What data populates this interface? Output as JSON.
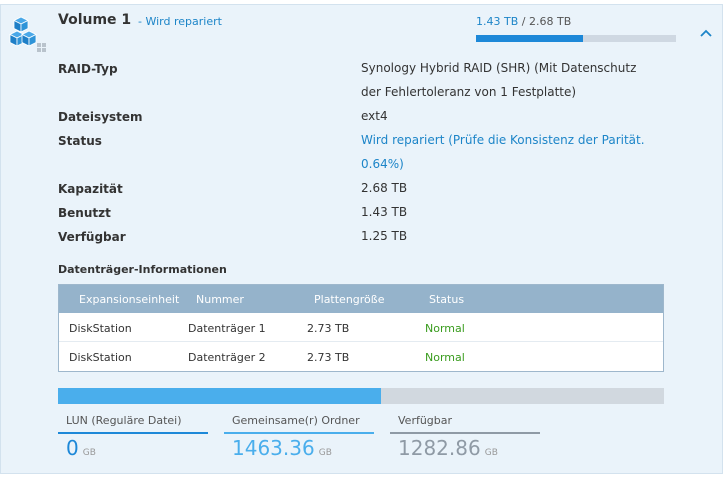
{
  "volume": {
    "title": "Volume 1",
    "status_separator": "-",
    "status": "Wird repariert",
    "usage_used": "1.43 TB",
    "usage_sep": "/",
    "usage_total": "2.68 TB",
    "usage_fraction": 0.533
  },
  "info": {
    "raid_label": "RAID-Typ",
    "raid_value_line1": "Synology Hybrid RAID (SHR) (Mit Datenschutz",
    "raid_value_line2": "der Fehlertoleranz von 1 Festplatte)",
    "fs_label": "Dateisystem",
    "fs_value": "ext4",
    "status_label": "Status",
    "status_value_line1": "Wird repariert (Prüfe die Konsistenz der Parität.",
    "status_value_line2": "0.64%)",
    "capacity_label": "Kapazität",
    "capacity_value": "2.68 TB",
    "used_label": "Benutzt",
    "used_value": "1.43 TB",
    "available_label": "Verfügbar",
    "available_value": "1.25 TB"
  },
  "disks": {
    "title": "Datenträger-Informationen",
    "headers": [
      "Expansionseinheit",
      "Nummer",
      "Plattengröße",
      "Status"
    ],
    "rows": [
      [
        "DiskStation",
        "Datenträger 1",
        "2.73 TB",
        "Normal"
      ],
      [
        "DiskStation",
        "Datenträger 2",
        "2.73 TB",
        "Normal"
      ]
    ]
  },
  "storage": {
    "used_fraction": 0.533,
    "lun_label": "LUN (Reguläre Datei)",
    "lun_value": "0",
    "lun_unit": "GB",
    "shared_label": "Gemeinsame(r) Ordner",
    "shared_value": "1463.36",
    "shared_unit": "GB",
    "free_label": "Verfügbar",
    "free_value": "1282.86",
    "free_unit": "GB"
  },
  "colors": {
    "accent": "#1d85c8",
    "normal": "#3a9c1e",
    "lun": "#1d88d8",
    "shared": "#4aaeec",
    "free": "#8f9aa5"
  },
  "icons": {
    "volume": "cubes-icon",
    "collapse": "chevron-up-icon"
  }
}
